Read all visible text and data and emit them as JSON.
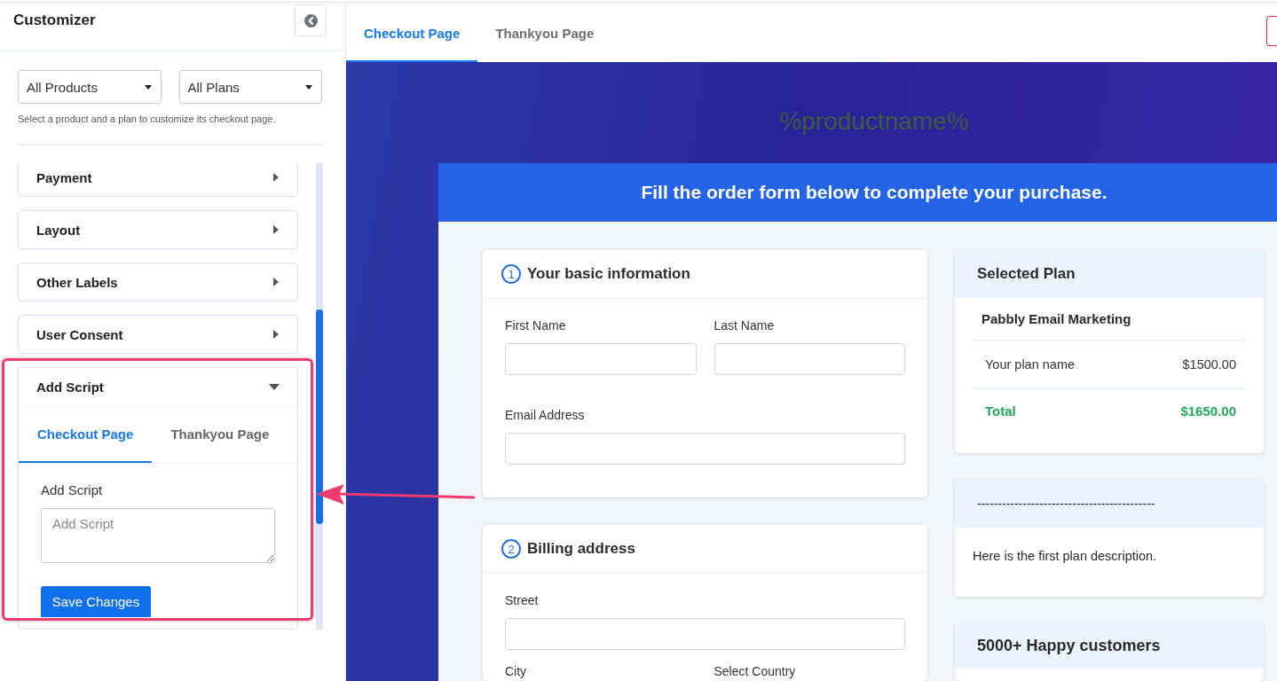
{
  "sidebar": {
    "title": "Customizer",
    "filters": [
      {
        "value": "All Products"
      },
      {
        "value": "All Plans"
      }
    ],
    "hint": "Select a product and a plan to customize its checkout page.",
    "sections": [
      {
        "label": "Payment",
        "expanded": false
      },
      {
        "label": "Layout",
        "expanded": false
      },
      {
        "label": "Other Labels",
        "expanded": false
      },
      {
        "label": "User Consent",
        "expanded": false
      },
      {
        "label": "Add Script",
        "expanded": true,
        "tabs": [
          {
            "label": "Checkout Page",
            "selected": true
          },
          {
            "label": "Thankyou Page",
            "selected": false
          }
        ],
        "field_label": "Add Script",
        "placeholder": "Add Script",
        "button": "Save Changes"
      }
    ]
  },
  "preview": {
    "tabs": [
      {
        "label": "Checkout Page",
        "selected": true
      },
      {
        "label": "Thankyou Page",
        "selected": false
      }
    ],
    "product_name": "%productname%",
    "banner": "Fill the order form below to complete your purchase.",
    "form_sections": [
      {
        "number": "1",
        "title": "Your basic information",
        "rows": [
          {
            "fields": [
              {
                "kind": "field",
                "label": "First Name"
              },
              {
                "kind": "field",
                "label": "Last Name"
              }
            ]
          },
          {
            "fields": [
              {
                "kind": "field",
                "label": "Email Address"
              }
            ]
          }
        ]
      },
      {
        "number": "2",
        "title": "Billing address",
        "rows": [
          {
            "fields": [
              {
                "kind": "field",
                "label": "Street"
              }
            ]
          },
          {
            "fields": [
              {
                "kind": "label_only",
                "label": "City"
              },
              {
                "kind": "label_only",
                "label": "Select Country"
              }
            ]
          }
        ]
      }
    ],
    "plan": {
      "title": "Selected Plan",
      "product": "Pabbly Email Marketing",
      "items": [
        {
          "name": "Your plan name",
          "price": "$1500.00"
        }
      ],
      "total_label": "Total",
      "total": "$1650.00"
    },
    "description": {
      "title": "-------------------------------------------",
      "text": "Here is the first plan description."
    },
    "testimonials": {
      "title": "5000+ Happy customers"
    }
  }
}
